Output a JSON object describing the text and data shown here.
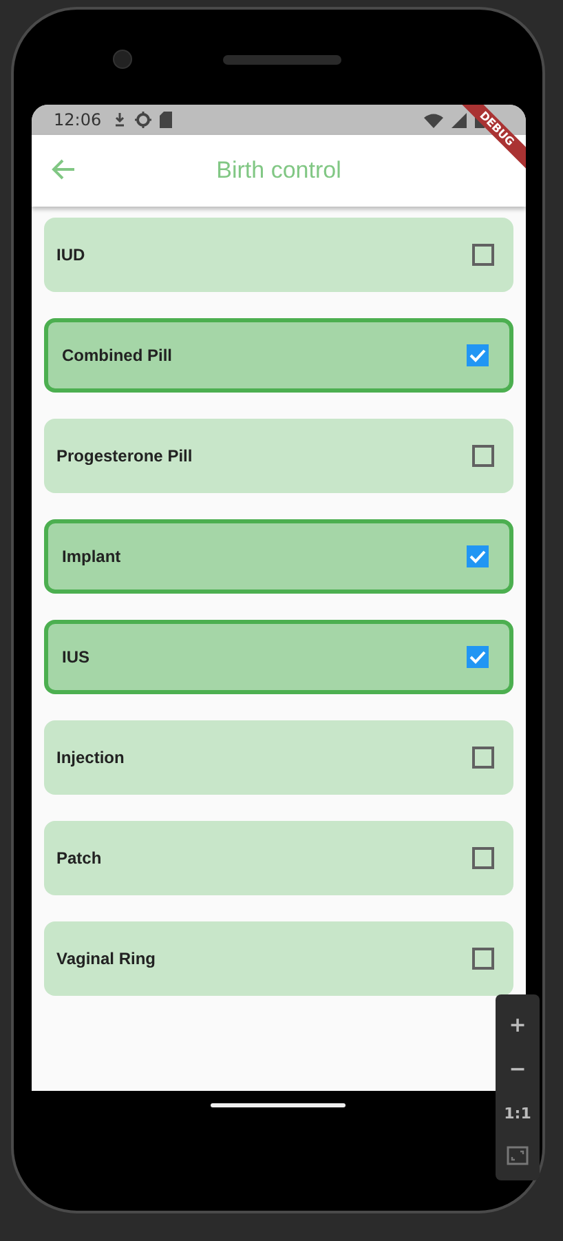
{
  "status_bar": {
    "time": "12:06"
  },
  "debug_banner": "DEBUG",
  "app_bar": {
    "title": "Birth control"
  },
  "options": [
    {
      "label": "IUD",
      "checked": false
    },
    {
      "label": "Combined Pill",
      "checked": true
    },
    {
      "label": "Progesterone Pill",
      "checked": false
    },
    {
      "label": "Implant",
      "checked": true
    },
    {
      "label": "IUS",
      "checked": true
    },
    {
      "label": "Injection",
      "checked": false
    },
    {
      "label": "Patch",
      "checked": false
    },
    {
      "label": "Vaginal Ring",
      "checked": false
    }
  ],
  "zoom_controls": [
    "+",
    "−",
    "1:1"
  ]
}
